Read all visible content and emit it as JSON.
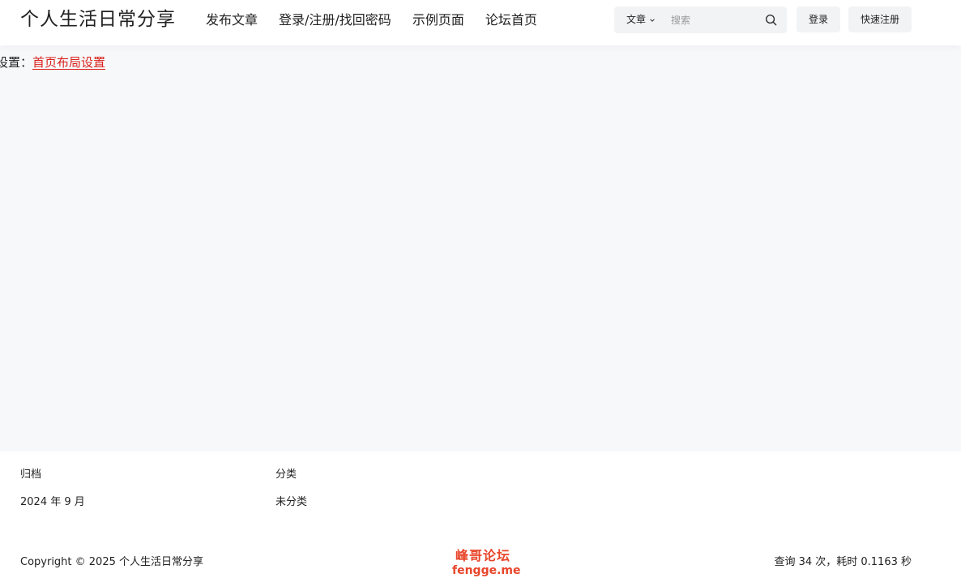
{
  "header": {
    "site_title": "个人生活日常分享",
    "nav": [
      {
        "label": "发布文章"
      },
      {
        "label": "登录/注册/找回密码"
      },
      {
        "label": "示例页面"
      },
      {
        "label": "论坛首页"
      }
    ],
    "search": {
      "type_label": "文章",
      "placeholder": "搜索",
      "icon": "search-icon"
    },
    "login_label": "登录",
    "register_label": "快速注册"
  },
  "main": {
    "notice_prefix": "设置：",
    "notice_link": "首页布局设置",
    "link_color": "#d9211a",
    "background": "#f7f8fa"
  },
  "footer": {
    "archive_title": "归档",
    "archive_items": [
      "2024 年 9 月"
    ],
    "category_title": "分类",
    "category_items": [
      "未分类"
    ],
    "copyright": "Copyright © 2025 个人生活日常分享",
    "watermark_line1": "峰哥论坛",
    "watermark_line2": "fengge.me",
    "watermark_color": "#e8452a",
    "stats": "查询 34 次，耗时 0.1163 秒"
  }
}
